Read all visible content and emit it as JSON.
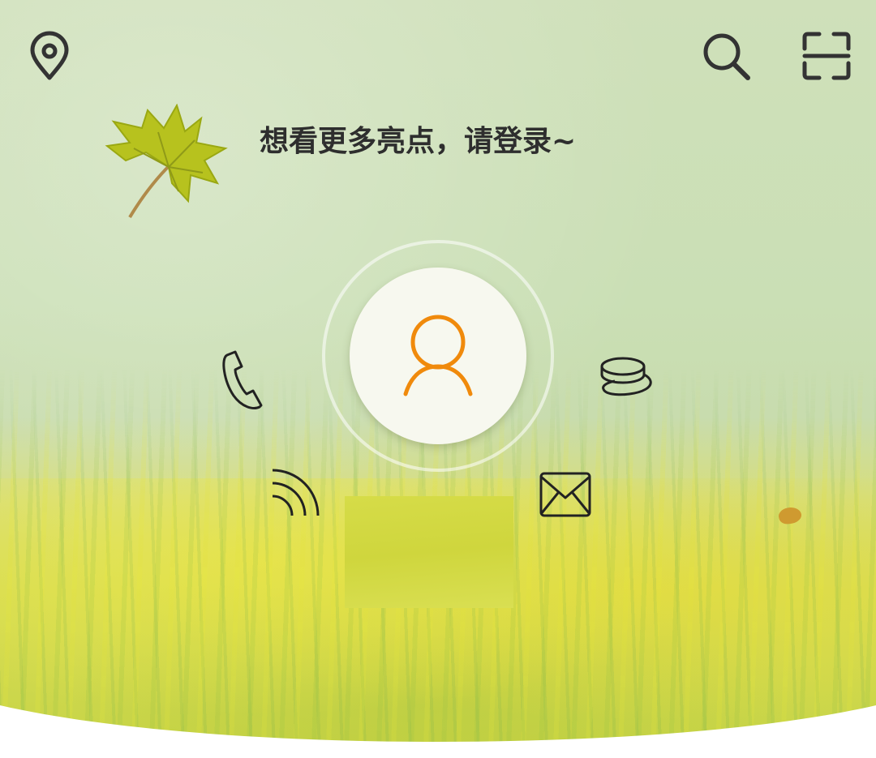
{
  "header": {
    "location_icon": "location-pin-icon",
    "search_icon": "search-icon",
    "scan_icon": "scan-icon"
  },
  "login_prompt": {
    "headline": "想看更多亮点，请登录~"
  },
  "avatar": {
    "icon": "user-icon",
    "accent_color": "#F08A0C"
  },
  "login_methods": [
    {
      "icon": "phone-icon"
    },
    {
      "icon": "coins-icon"
    },
    {
      "icon": "signal-icon"
    },
    {
      "icon": "mail-icon"
    }
  ],
  "colors": {
    "icon_stroke": "#333333",
    "headline_text": "#2E2E2E",
    "avatar_background": "#F7F8EF"
  }
}
